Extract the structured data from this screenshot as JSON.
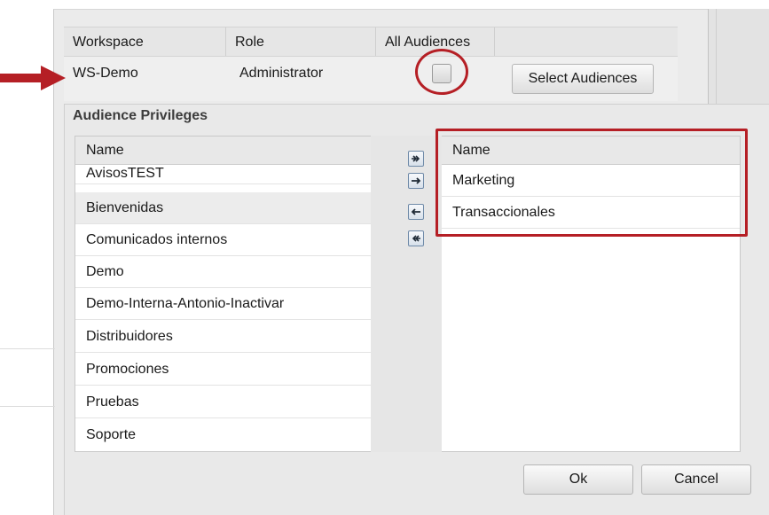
{
  "workspace_grid": {
    "headers": [
      "Workspace",
      "Role",
      "All Audiences"
    ],
    "row": {
      "workspace": "WS-Demo",
      "role": "Administrator",
      "all_audiences_checked": false
    },
    "select_audiences_label": "Select Audiences"
  },
  "dialog": {
    "title": "Audience Privileges",
    "available": {
      "header": "Name",
      "items": [
        "AvisosTEST",
        "Bienvenidas",
        "Comunicados internos",
        "Demo",
        "Demo-Interna-Antonio-Inactivar",
        "Distribuidores",
        "Promociones",
        "Pruebas",
        "Soporte"
      ],
      "selected_index": 1
    },
    "assigned": {
      "header": "Name",
      "items": [
        "Marketing",
        "Transaccionales"
      ]
    },
    "move_buttons": [
      "move-all-right-icon",
      "move-right-icon",
      "move-left-icon",
      "move-all-left-icon"
    ],
    "ok_label": "Ok",
    "cancel_label": "Cancel"
  },
  "annotation_color": "#b51f25"
}
